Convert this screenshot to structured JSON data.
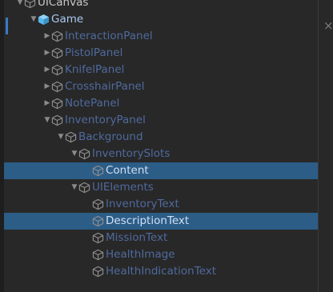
{
  "hierarchy": {
    "rows": [
      {
        "label": "UICanvas",
        "depth": 0,
        "arrow": "down",
        "icon": "cube-outline-icon"
      },
      {
        "label": "Game",
        "depth": 1,
        "arrow": "down",
        "icon": "cube-solid-icon"
      },
      {
        "label": "InteractionPanel",
        "depth": 2,
        "arrow": "right",
        "icon": "cube-outline-icon"
      },
      {
        "label": "PistolPanel",
        "depth": 2,
        "arrow": "right",
        "icon": "cube-outline-icon"
      },
      {
        "label": "KnifelPanel",
        "depth": 2,
        "arrow": "right",
        "icon": "cube-outline-icon"
      },
      {
        "label": "CrosshairPanel",
        "depth": 2,
        "arrow": "right",
        "icon": "cube-outline-icon"
      },
      {
        "label": "NotePanel",
        "depth": 2,
        "arrow": "right",
        "icon": "cube-outline-icon"
      },
      {
        "label": "InventoryPanel",
        "depth": 2,
        "arrow": "down",
        "icon": "cube-outline-icon"
      },
      {
        "label": "Background",
        "depth": 3,
        "arrow": "down",
        "icon": "cube-outline-icon"
      },
      {
        "label": "InventorySlots",
        "depth": 4,
        "arrow": "down",
        "icon": "cube-outline-icon"
      },
      {
        "label": "Content",
        "depth": 5,
        "arrow": "none",
        "icon": "cube-outline-icon",
        "selected": true
      },
      {
        "label": "UIElements",
        "depth": 4,
        "arrow": "down",
        "icon": "cube-outline-icon"
      },
      {
        "label": "InventoryText",
        "depth": 5,
        "arrow": "none",
        "icon": "cube-outline-icon"
      },
      {
        "label": "DescriptionText",
        "depth": 5,
        "arrow": "none",
        "icon": "cube-outline-icon",
        "selected": true
      },
      {
        "label": "MissionText",
        "depth": 5,
        "arrow": "none",
        "icon": "cube-outline-icon"
      },
      {
        "label": "HealthImage",
        "depth": 5,
        "arrow": "none",
        "icon": "cube-outline-icon"
      },
      {
        "label": "HealthIndicationText",
        "depth": 5,
        "arrow": "none",
        "icon": "cube-outline-icon"
      }
    ]
  },
  "close_glyph": "×",
  "colors": {
    "background": "#282828",
    "selection": "#2c5d87",
    "accent": "#3a7ac8",
    "inactive_label": "#4f6a9e",
    "active_label": "#cfe0f5",
    "cube_solid": "#5bb7ea"
  }
}
